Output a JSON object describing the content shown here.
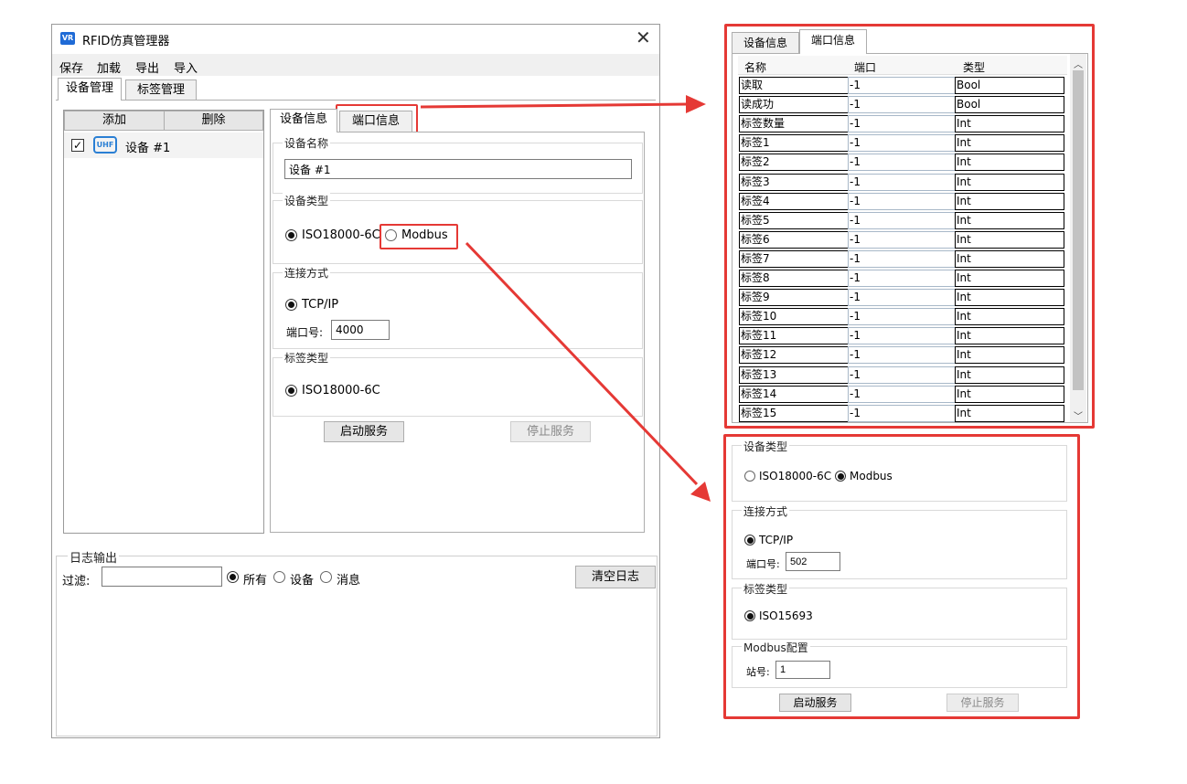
{
  "window": {
    "icon_text": "VR",
    "title": "RFID仿真管理器",
    "close_glyph": "✕",
    "menu": [
      "保存",
      "加载",
      "导出",
      "导入"
    ]
  },
  "main_tabs": [
    "设备管理",
    "标签管理"
  ],
  "device_list": {
    "add_label": "添加",
    "delete_label": "删除",
    "items": [
      {
        "checked": true,
        "icon": "uhf-reader-icon",
        "icon_text": "UHF",
        "name": "设备 #1"
      }
    ]
  },
  "detail_tabs": [
    "设备信息",
    "端口信息"
  ],
  "device_name": {
    "legend": "设备名称",
    "value": "设备 #1"
  },
  "device_type": {
    "legend": "设备类型",
    "options": [
      "ISO18000-6C",
      "Modbus"
    ],
    "selected": "ISO18000-6C"
  },
  "connection": {
    "legend": "连接方式",
    "option": "TCP/IP",
    "port_label": "端口号:",
    "port_value": "4000"
  },
  "tag_type": {
    "legend": "标签类型",
    "option": "ISO18000-6C"
  },
  "buttons": {
    "start": "启动服务",
    "stop": "停止服务"
  },
  "log": {
    "legend": "日志输出",
    "filter_label": "过滤:",
    "filter_value": "",
    "filters": [
      "所有",
      "设备",
      "消息"
    ],
    "selected": "所有",
    "clear_label": "清空日志"
  },
  "port_panel": {
    "tabs": [
      "设备信息",
      "端口信息"
    ],
    "columns": [
      "名称",
      "端口",
      "类型"
    ],
    "rows": [
      [
        "读取",
        "-1",
        "Bool"
      ],
      [
        "读成功",
        "-1",
        "Bool"
      ],
      [
        "标签数量",
        "-1",
        "Int"
      ],
      [
        "标签1",
        "-1",
        "Int"
      ],
      [
        "标签2",
        "-1",
        "Int"
      ],
      [
        "标签3",
        "-1",
        "Int"
      ],
      [
        "标签4",
        "-1",
        "Int"
      ],
      [
        "标签5",
        "-1",
        "Int"
      ],
      [
        "标签6",
        "-1",
        "Int"
      ],
      [
        "标签7",
        "-1",
        "Int"
      ],
      [
        "标签8",
        "-1",
        "Int"
      ],
      [
        "标签9",
        "-1",
        "Int"
      ],
      [
        "标签10",
        "-1",
        "Int"
      ],
      [
        "标签11",
        "-1",
        "Int"
      ],
      [
        "标签12",
        "-1",
        "Int"
      ],
      [
        "标签13",
        "-1",
        "Int"
      ],
      [
        "标签14",
        "-1",
        "Int"
      ],
      [
        "标签15",
        "-1",
        "Int"
      ]
    ]
  },
  "modbus_panel": {
    "device_type_legend": "设备类型",
    "type_options": [
      "ISO18000-6C",
      "Modbus"
    ],
    "type_selected": "Modbus",
    "connection_legend": "连接方式",
    "connection_option": "TCP/IP",
    "port_label": "端口号:",
    "port_value": "502",
    "tag_legend": "标签类型",
    "tag_option": "ISO15693",
    "modbus_legend": "Modbus配置",
    "station_label": "站号:",
    "station_value": "1",
    "start": "启动服务",
    "stop": "停止服务"
  },
  "colors": {
    "highlight": "#e53935",
    "tab_bg": "#f0f0f0",
    "border": "#adadad"
  }
}
